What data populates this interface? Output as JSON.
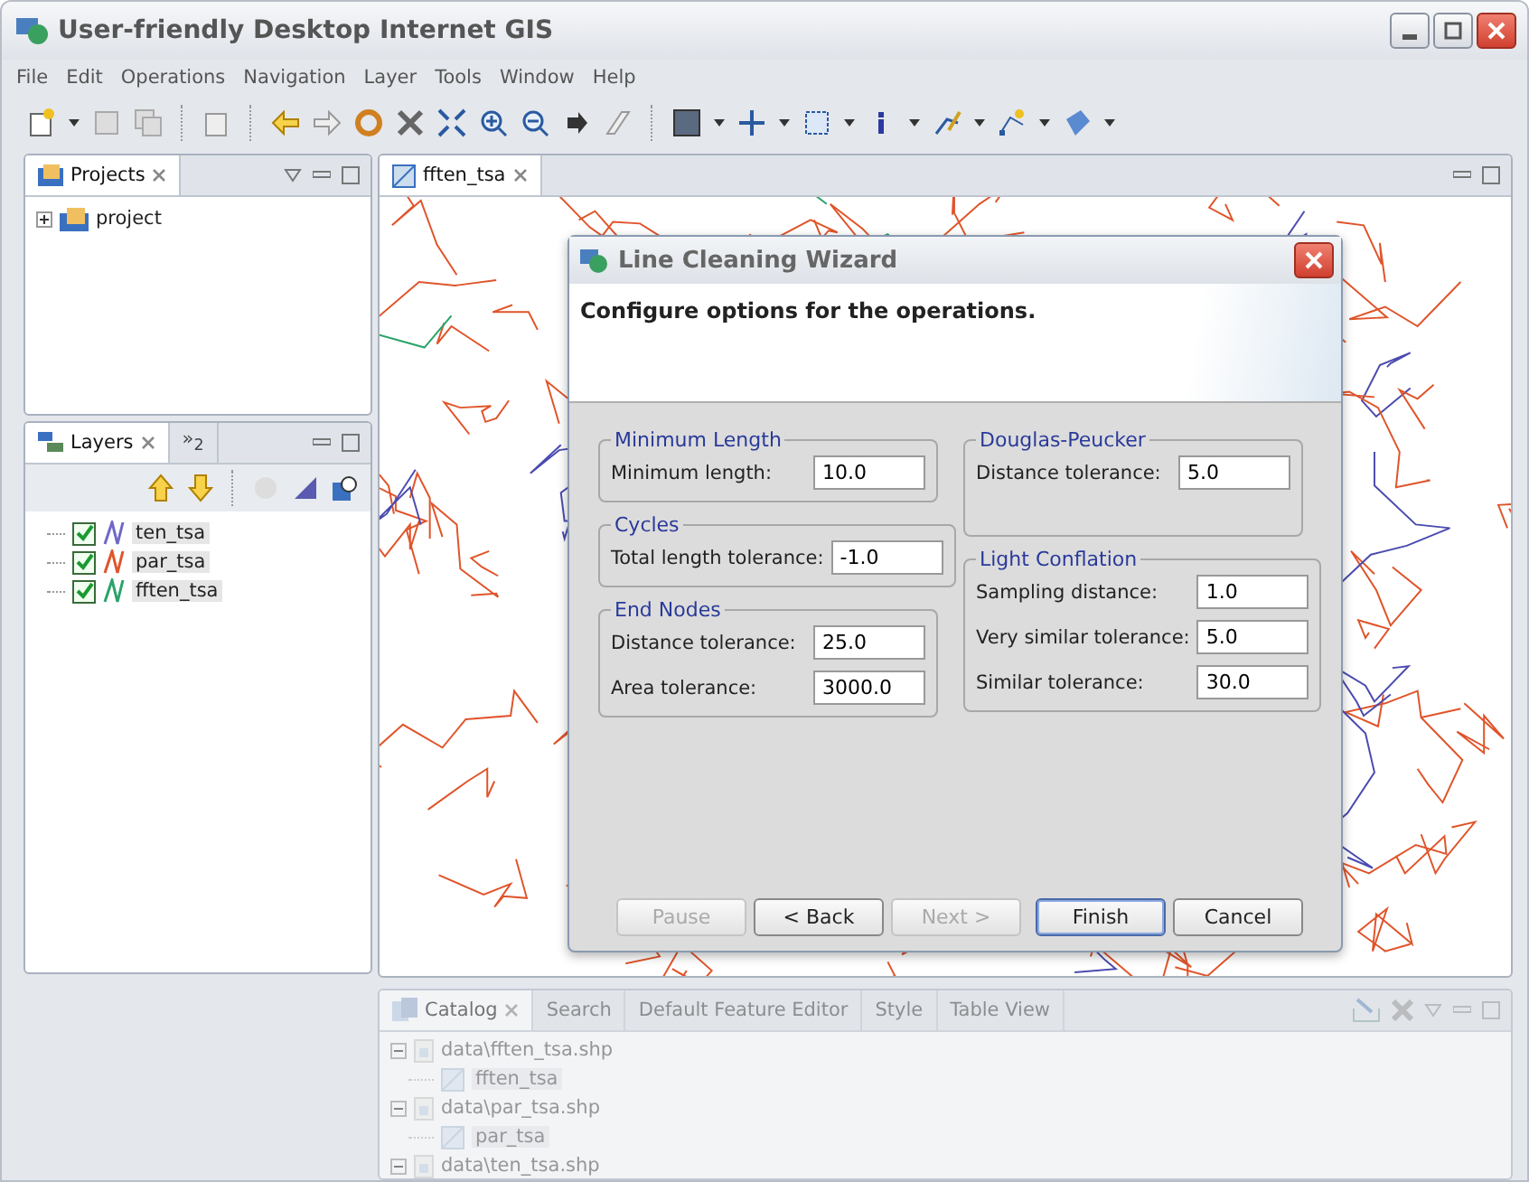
{
  "window": {
    "title": "User-friendly Desktop Internet GIS"
  },
  "menu": [
    "File",
    "Edit",
    "Operations",
    "Navigation",
    "Layer",
    "Tools",
    "Window",
    "Help"
  ],
  "projects_panel": {
    "tab": "Projects",
    "tree": [
      {
        "label": "project",
        "expanded": false
      }
    ]
  },
  "layers_panel": {
    "tabs": [
      {
        "label": "Layers",
        "selected": true
      },
      {
        "label": "»$_{2}$",
        "selected": false
      }
    ],
    "layers": [
      {
        "name": "ten_tsa",
        "checked": true,
        "color": "#6f68c8"
      },
      {
        "name": "par_tsa",
        "checked": true,
        "color": "#e0542a"
      },
      {
        "name": "fften_tsa",
        "checked": true,
        "color": "#2aa36a"
      }
    ]
  },
  "editor": {
    "tab": "fften_tsa"
  },
  "dialog": {
    "title": "Line Cleaning Wizard",
    "heading": "Configure options for the operations.",
    "left_groups": [
      {
        "title": "Minimum Length",
        "fields": [
          {
            "label": "Minimum length:",
            "value": "10.0"
          }
        ]
      },
      {
        "title": "Cycles",
        "fields": [
          {
            "label": "Total length tolerance:",
            "value": "-1.0"
          }
        ]
      },
      {
        "title": "End Nodes",
        "fields": [
          {
            "label": "Distance tolerance:",
            "value": "25.0"
          },
          {
            "label": "Area tolerance:",
            "value": "3000.0"
          }
        ]
      }
    ],
    "right_groups": [
      {
        "title": "Douglas-Peucker",
        "fields": [
          {
            "label": "Distance tolerance:",
            "value": "5.0"
          }
        ]
      },
      {
        "title": "Light Conflation",
        "fields": [
          {
            "label": "Sampling distance:",
            "value": "1.0"
          },
          {
            "label": "Very similar tolerance:",
            "value": "5.0"
          },
          {
            "label": "Similar tolerance:",
            "value": "30.0"
          }
        ]
      }
    ],
    "buttons": [
      {
        "label": "Pause",
        "disabled": true,
        "default": false
      },
      {
        "label": "< Back",
        "disabled": false,
        "default": false
      },
      {
        "label": "Next >",
        "disabled": true,
        "default": false
      },
      {
        "label": "Finish",
        "disabled": false,
        "default": true
      },
      {
        "label": "Cancel",
        "disabled": false,
        "default": false
      }
    ]
  },
  "bottom_panel": {
    "tabs": [
      {
        "label": "Catalog",
        "selected": true
      },
      {
        "label": "Search",
        "selected": false
      },
      {
        "label": "Default Feature Editor",
        "selected": false
      },
      {
        "label": "Style",
        "selected": false
      },
      {
        "label": "Table View",
        "selected": false
      }
    ],
    "tree": [
      {
        "label": "data\\fften_tsa.shp",
        "expanded": true,
        "children": [
          {
            "label": "fften_tsa"
          }
        ]
      },
      {
        "label": "data\\par_tsa.shp",
        "expanded": true,
        "children": [
          {
            "label": "par_tsa"
          }
        ]
      },
      {
        "label": "data\\ten_tsa.shp",
        "expanded": true
      }
    ]
  }
}
